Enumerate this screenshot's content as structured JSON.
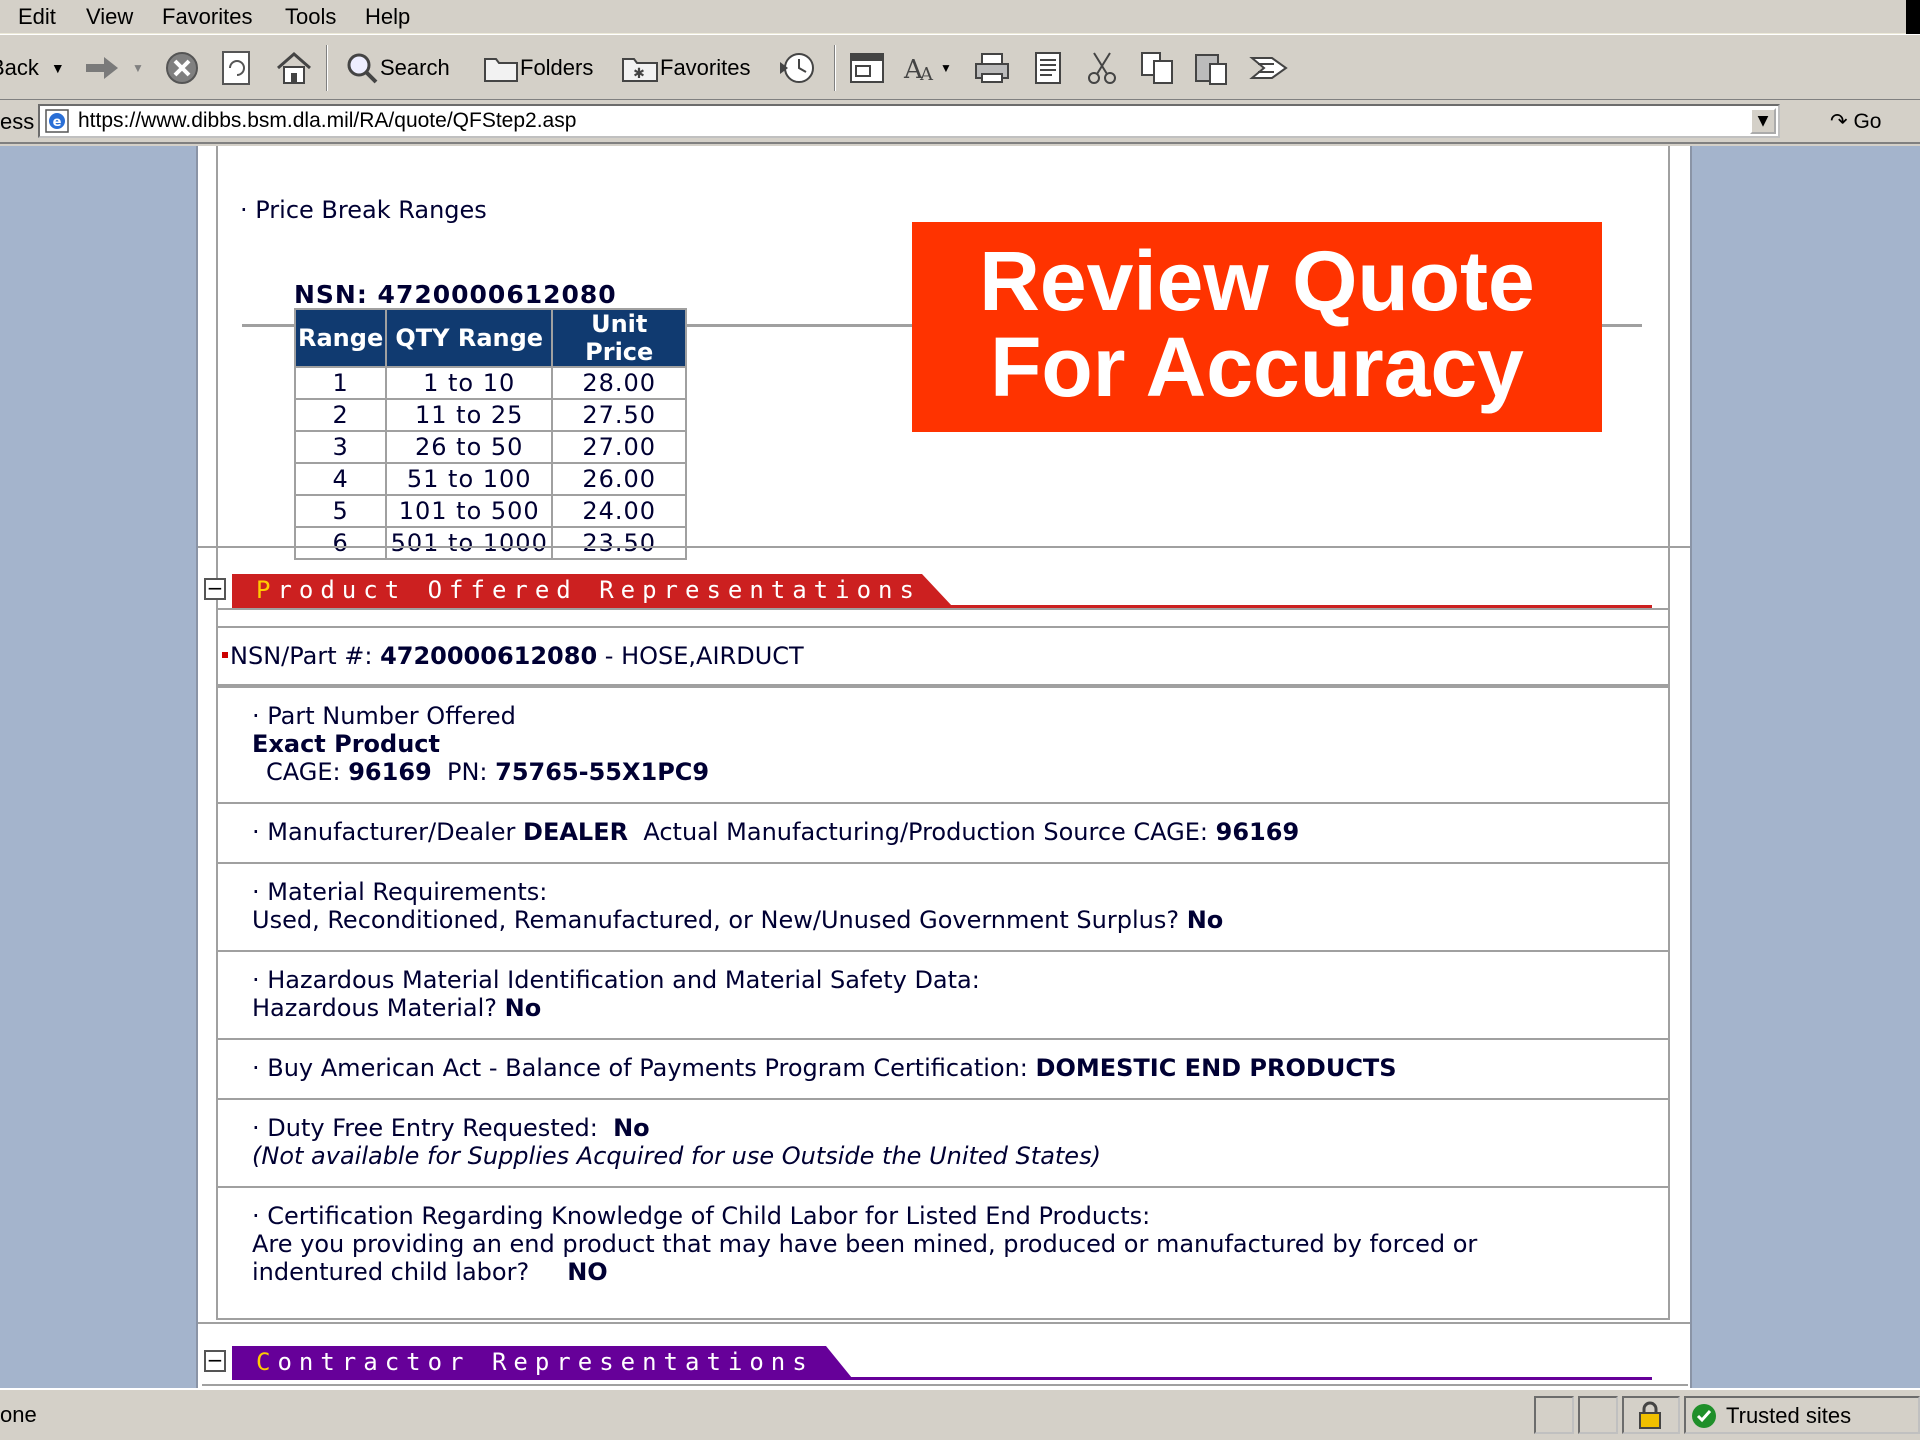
{
  "menu": {
    "items": [
      "Edit",
      "View",
      "Favorites",
      "Tools",
      "Help"
    ]
  },
  "toolbar": {
    "back_label": "Back",
    "search_label": "Search",
    "folders_label": "Folders",
    "favorites_label": "Favorites"
  },
  "address": {
    "label": "ess",
    "url": "https://www.dibbs.bsm.dla.mil/RA/quote/QFStep2.asp",
    "go_label": "Go"
  },
  "price_break": {
    "title": "· Price Break Ranges",
    "nsn_heading": "NSN: 4720000612080",
    "headers": [
      "Range",
      "QTY Range",
      "Unit Price"
    ],
    "rows": [
      [
        "1",
        "1  to 10",
        "28.00"
      ],
      [
        "2",
        "11  to 25",
        "27.50"
      ],
      [
        "3",
        "26  to 50",
        "27.00"
      ],
      [
        "4",
        "51  to 100",
        "26.00"
      ],
      [
        "5",
        "101  to 500",
        "24.00"
      ],
      [
        "6",
        "501  to 1000",
        "23.50"
      ]
    ]
  },
  "banner": {
    "line1": "Review Quote",
    "line2": "For Accuracy"
  },
  "product_section": {
    "toggle": "−",
    "first_letter": "P",
    "rest_title": "roduct  Offered  Representations",
    "nsn_label": "NSN/Part #: ",
    "nsn_value": "4720000612080",
    "nsn_desc": " - HOSE,AIRDUCT",
    "part_offered_label": "· Part Number Offered",
    "exact_product": "Exact Product",
    "cage_label": "CAGE: ",
    "cage_value": "96169",
    "pn_label": "  PN: ",
    "pn_value": "75765-55X1PC9",
    "mfr_label": "· Manufacturer/Dealer ",
    "mfr_value": "DEALER",
    "source_label": "  Actual Manufacturing/Production Source CAGE: ",
    "source_value": "96169",
    "material_label": "· Material Requirements:",
    "material_q": "Used, Reconditioned, Remanufactured, or New/Unused Government Surplus? ",
    "material_a": "No",
    "hazmat_label": "· Hazardous Material Identification and Material Safety Data:",
    "hazmat_q": "Hazardous Material? ",
    "hazmat_a": "No",
    "buy_american_label": "· Buy American Act - Balance of Payments Program Certification: ",
    "buy_american_value": "DOMESTIC END PRODUCTS",
    "duty_label": "· Duty Free Entry Requested:  ",
    "duty_value": "No",
    "duty_note": "(Not available for Supplies Acquired for use Outside the United States)",
    "child_labor_label": "· Certification Regarding Knowledge of Child Labor for Listed End Products:",
    "child_labor_q1": "Are you providing an end product that may have been mined, produced or manufactured by forced or",
    "child_labor_q2": "indentured child labor?",
    "child_labor_a": "NO"
  },
  "contractor_section": {
    "toggle": "−",
    "first_letter": "C",
    "rest_title": "ontractor  Representations"
  },
  "status": {
    "text": "one",
    "zone": "Trusted sites"
  },
  "colors": {
    "banner": "#ff3300",
    "product_tab": "#cc2020",
    "contractor_tab": "#660099",
    "table_header": "#103a70"
  }
}
